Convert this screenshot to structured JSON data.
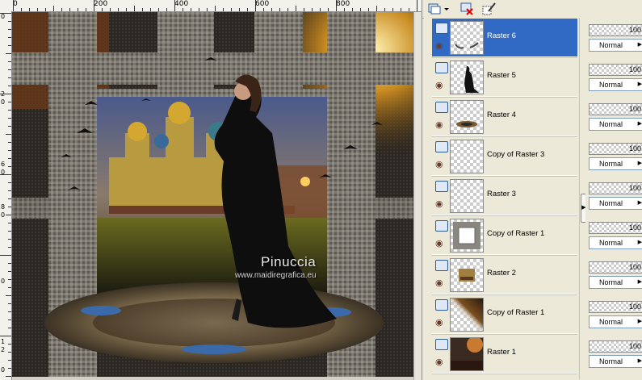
{
  "ruler": {
    "top_labels": [
      "0",
      "200",
      "400",
      "600",
      "800"
    ],
    "left_labels": [
      "0",
      "2",
      "0",
      "6",
      "0",
      "8",
      "0",
      "0",
      "1",
      "2",
      "0"
    ]
  },
  "watermark": {
    "name": "Pinuccia",
    "url": "www.maidiregrafica.eu"
  },
  "toolbar": {
    "icons": [
      "new-layer-icon",
      "delete-layer-icon",
      "edit-mask-icon"
    ]
  },
  "layers": [
    {
      "name": "Raster 6",
      "selected": true,
      "opacity": "100",
      "blend": "Normal"
    },
    {
      "name": "Raster 5",
      "selected": false,
      "opacity": "100",
      "blend": "Normal"
    },
    {
      "name": "Raster 4",
      "selected": false,
      "opacity": "100",
      "blend": "Normal"
    },
    {
      "name": "Copy of Raster 3",
      "selected": false,
      "opacity": "100",
      "blend": "Normal"
    },
    {
      "name": "Raster 3",
      "selected": false,
      "opacity": "100",
      "blend": "Normal"
    },
    {
      "name": "Copy of Raster 1",
      "selected": false,
      "opacity": "100",
      "blend": "Normal"
    },
    {
      "name": "Raster 2",
      "selected": false,
      "opacity": "100",
      "blend": "Normal"
    },
    {
      "name": "Copy of Raster 1",
      "selected": false,
      "opacity": "100",
      "blend": "Normal"
    },
    {
      "name": "Raster 1",
      "selected": false,
      "opacity": "100",
      "blend": "Normal"
    }
  ],
  "colors": {
    "selection": "#316ac5",
    "panel_bg": "#ece9d8"
  }
}
